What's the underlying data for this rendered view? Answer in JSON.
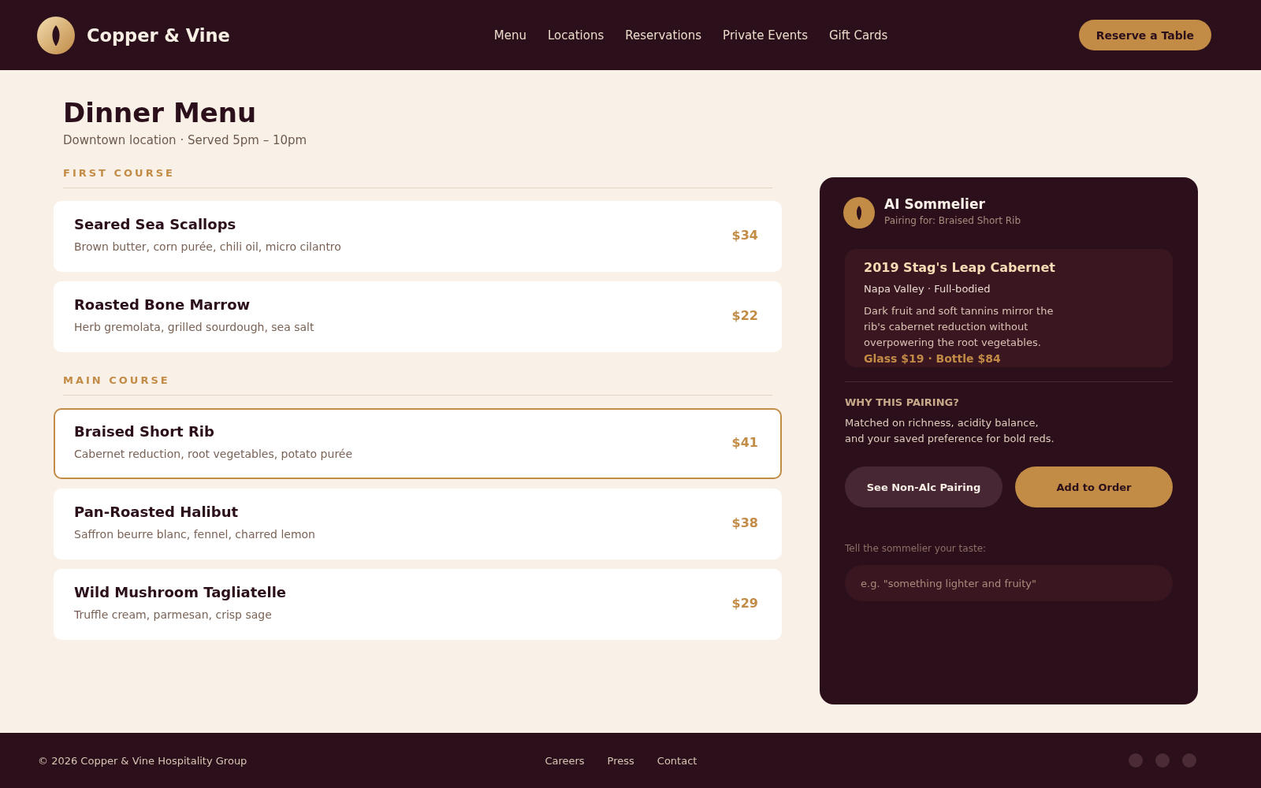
{
  "header": {
    "brand": "Copper & Vine",
    "nav": [
      "Menu",
      "Locations",
      "Reservations",
      "Private Events",
      "Gift Cards"
    ],
    "cta": "Reserve a Table"
  },
  "page": {
    "title": "Dinner Menu",
    "subtitle": "Downtown location · Served 5pm – 10pm"
  },
  "sections": [
    {
      "heading": "FIRST COURSE",
      "items": [
        {
          "name": "Seared Sea Scallops",
          "description": "Brown butter, corn purée, chili oil, micro cilantro",
          "price": "$34",
          "selected": false
        },
        {
          "name": "Roasted Bone Marrow",
          "description": "Herb gremolata, grilled sourdough, sea salt",
          "price": "$22",
          "selected": false
        }
      ]
    },
    {
      "heading": "MAIN COURSE",
      "items": [
        {
          "name": "Braised Short Rib",
          "description": "Cabernet reduction, root vegetables, potato purée",
          "price": "$41",
          "selected": true
        },
        {
          "name": "Pan-Roasted Halibut",
          "description": "Saffron beurre blanc, fennel, charred lemon",
          "price": "$38",
          "selected": false
        },
        {
          "name": "Wild Mushroom Tagliatelle",
          "description": "Truffle cream, parmesan, crisp sage",
          "price": "$29",
          "selected": false
        }
      ]
    }
  ],
  "sommelier": {
    "title": "AI Sommelier",
    "subtitle": "Pairing for: Braised Short Rib",
    "wine": {
      "name": "2019 Stag's Leap Cabernet",
      "details": "Napa Valley · Full-bodied",
      "note": "Dark fruit and soft tannins mirror the rib's cabernet reduction without overpowering the root vegetables.",
      "price": "Glass $19 · Bottle $84"
    },
    "why_heading": "WHY THIS PAIRING?",
    "why_text": "Matched on richness, acidity balance, and your saved preference for bold reds.",
    "buttons": [
      {
        "label": "See Non-Alc Pairing",
        "kind": "secondary"
      },
      {
        "label": "Add to Order",
        "kind": "primary"
      }
    ],
    "input": {
      "label": "Tell the sommelier your taste:",
      "placeholder": "e.g. \"something lighter and fruity\""
    }
  },
  "footer": {
    "copyright": "© 2026 Copper & Vine Hospitality Group",
    "links": [
      "Careers",
      "Press",
      "Contact"
    ]
  }
}
